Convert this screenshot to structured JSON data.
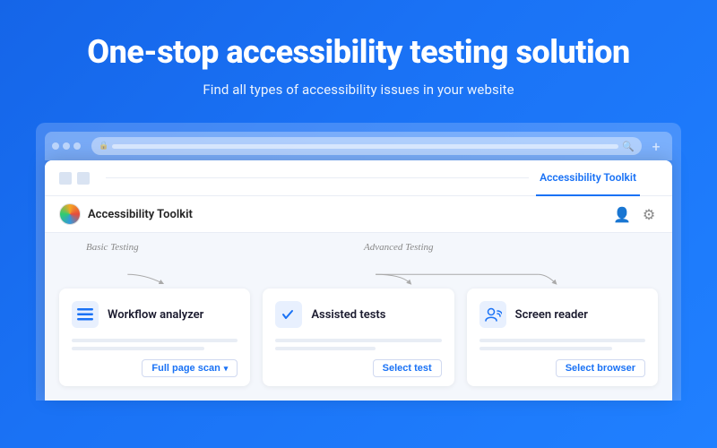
{
  "hero": {
    "title": "One-stop accessibility testing solution",
    "subtitle": "Find all types of accessibility issues in your website"
  },
  "browser": {
    "tab_label": "Accessibility Toolkit",
    "new_tab_icon": "+",
    "address_placeholder": ""
  },
  "panel": {
    "app_name": "Accessibility Toolkit",
    "tab_name": "Accessibility Toolkit"
  },
  "labels": {
    "basic_testing": "Basic Testing",
    "advanced_testing": "Advanced Testing"
  },
  "cards": [
    {
      "id": "workflow-analyzer",
      "icon": "☰",
      "title": "Workflow analyzer",
      "action_label": "Full page scan",
      "has_chevron": true
    },
    {
      "id": "assisted-tests",
      "icon": "✓",
      "title": "Assisted tests",
      "action_label": "Select test",
      "has_chevron": false
    },
    {
      "id": "screen-reader",
      "icon": "👤",
      "title": "Screen reader",
      "action_label": "Select browser",
      "has_chevron": false
    }
  ],
  "icons": {
    "user": "👤",
    "gear": "⚙",
    "lock": "🔒",
    "search": "🔍"
  }
}
